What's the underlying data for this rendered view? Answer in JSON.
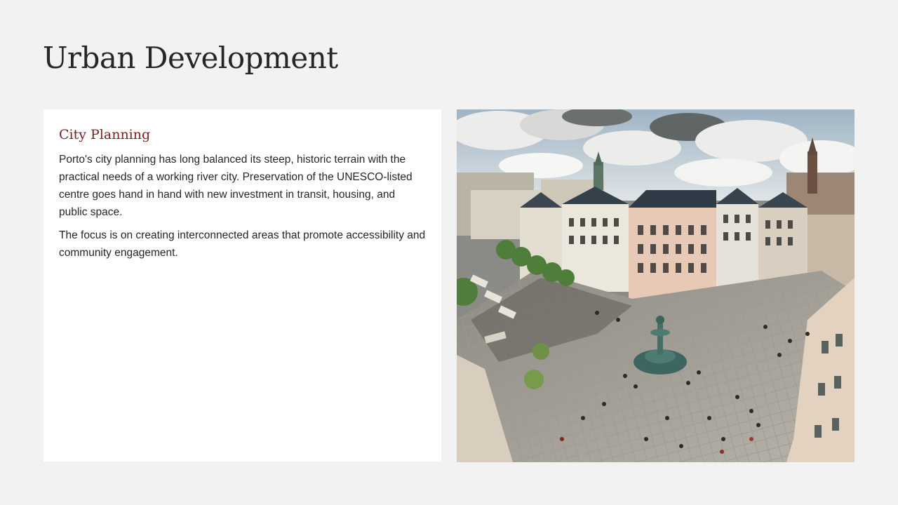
{
  "slide": {
    "title": "Urban Development"
  },
  "card": {
    "heading": "City Planning",
    "paragraphs": [
      "Porto's city planning has long balanced its steep, historic terrain with the practical needs of a working river city. Preservation of the UNESCO-listed centre goes hand in hand with new investment in transit, housing, and public space.",
      "The focus is on creating interconnected areas that promote accessibility and community engagement."
    ]
  },
  "photo": {
    "subject": "aerial-city-square-photo"
  },
  "colors": {
    "background": "#f2f2f2",
    "heading_accent": "#7a1f1f",
    "body_text": "#262626",
    "card_background": "#ffffff"
  }
}
